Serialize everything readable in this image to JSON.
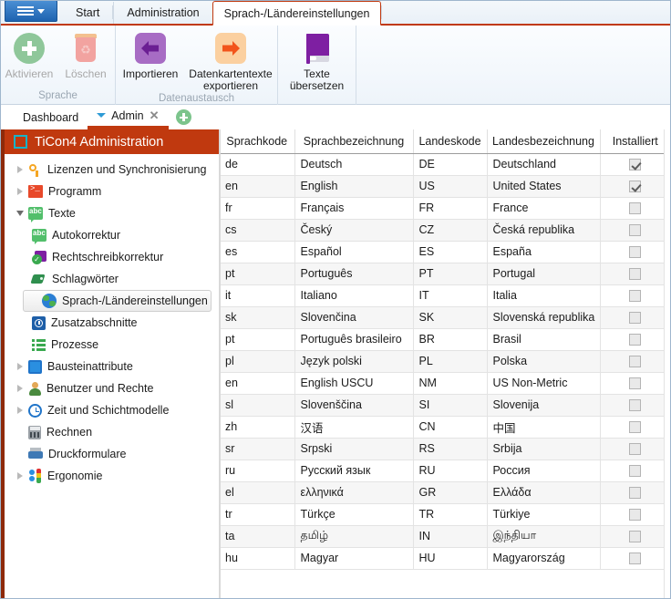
{
  "window": {
    "app_menu_icon": "hamburger-menu-icon"
  },
  "ribbon": {
    "tabs": [
      {
        "label": "Start",
        "active": false
      },
      {
        "label": "Administration",
        "active": false
      },
      {
        "label": "Sprach-/Ländereinstellungen",
        "active": true
      }
    ],
    "groups": [
      {
        "title": "Sprache",
        "buttons": [
          {
            "label": "Aktivieren",
            "icon": "plus-circle-icon",
            "disabled": true
          },
          {
            "label": "Löschen",
            "icon": "trash-icon",
            "disabled": true
          }
        ]
      },
      {
        "title": "Datenaustausch",
        "buttons": [
          {
            "label": "Importieren",
            "icon": "arrow-left-icon",
            "disabled": false
          },
          {
            "label": "Datenkartentexte exportieren",
            "icon": "arrow-right-icon",
            "disabled": false
          }
        ]
      },
      {
        "title": "",
        "buttons": [
          {
            "label": "Texte übersetzen",
            "icon": "book-icon",
            "disabled": false
          }
        ]
      }
    ]
  },
  "doc_tabs": {
    "items": [
      {
        "label": "Dashboard",
        "active": false,
        "closable": false,
        "has_dropdown": false
      },
      {
        "label": "Admin",
        "active": true,
        "closable": true,
        "has_dropdown": true
      }
    ],
    "add_label": "+"
  },
  "panel": {
    "title": "TiCon4 Administration",
    "icon": "frame-icon",
    "accent_color": "#c0390f"
  },
  "tree": {
    "items": [
      {
        "label": "Lizenzen und Synchronisierung",
        "icon": "key-icon",
        "indent": 0,
        "state": "collapsed",
        "selected": false
      },
      {
        "label": "Programm",
        "icon": "console-icon",
        "indent": 0,
        "state": "collapsed",
        "selected": false
      },
      {
        "label": "Texte",
        "icon": "abc-icon",
        "indent": 0,
        "state": "expanded",
        "selected": false
      },
      {
        "label": "Autokorrektur",
        "icon": "abc-icon",
        "indent": 1,
        "state": "leaf",
        "selected": false
      },
      {
        "label": "Rechtschreibkorrektur",
        "icon": "spellcheck-icon",
        "indent": 1,
        "state": "leaf",
        "selected": false
      },
      {
        "label": "Schlagwörter",
        "icon": "tag-icon",
        "indent": 1,
        "state": "leaf",
        "selected": false
      },
      {
        "label": "Sprach-/Ländereinstellungen",
        "icon": "globe-icon",
        "indent": 1,
        "state": "leaf",
        "selected": true
      },
      {
        "label": "Zusatzabschnitte",
        "icon": "clock-box-icon",
        "indent": 1,
        "state": "leaf",
        "selected": false
      },
      {
        "label": "Prozesse",
        "icon": "list-icon",
        "indent": 1,
        "state": "leaf",
        "selected": false
      },
      {
        "label": "Bausteinattribute",
        "icon": "blue-square-icon",
        "indent": 0,
        "state": "collapsed",
        "selected": false
      },
      {
        "label": "Benutzer und Rechte",
        "icon": "user-icon",
        "indent": 0,
        "state": "collapsed",
        "selected": false
      },
      {
        "label": "Zeit und Schichtmodelle",
        "icon": "clock-icon",
        "indent": 0,
        "state": "collapsed",
        "selected": false
      },
      {
        "label": "Rechnen",
        "icon": "calculator-icon",
        "indent": 0,
        "state": "leaf",
        "selected": false
      },
      {
        "label": "Druckformulare",
        "icon": "printer-icon",
        "indent": 0,
        "state": "leaf",
        "selected": false
      },
      {
        "label": "Ergonomie",
        "icon": "ergonomics-icon",
        "indent": 0,
        "state": "collapsed",
        "selected": false
      }
    ]
  },
  "grid": {
    "columns": [
      "Sprachkode",
      "Sprachbezeichnung",
      "Landeskode",
      "Landesbezeichnung",
      "Installiert"
    ],
    "rows": [
      {
        "sprachkode": "de",
        "sprachbezeichnung": "Deutsch",
        "landeskode": "DE",
        "landesbezeichnung": "Deutschland",
        "installiert": true
      },
      {
        "sprachkode": "en",
        "sprachbezeichnung": "English",
        "landeskode": "US",
        "landesbezeichnung": "United States",
        "installiert": true
      },
      {
        "sprachkode": "fr",
        "sprachbezeichnung": "Français",
        "landeskode": "FR",
        "landesbezeichnung": "France",
        "installiert": false
      },
      {
        "sprachkode": "cs",
        "sprachbezeichnung": "Český",
        "landeskode": "CZ",
        "landesbezeichnung": "Česká republika",
        "installiert": false
      },
      {
        "sprachkode": "es",
        "sprachbezeichnung": "Español",
        "landeskode": "ES",
        "landesbezeichnung": "España",
        "installiert": false
      },
      {
        "sprachkode": "pt",
        "sprachbezeichnung": "Português",
        "landeskode": "PT",
        "landesbezeichnung": "Portugal",
        "installiert": false
      },
      {
        "sprachkode": "it",
        "sprachbezeichnung": "Italiano",
        "landeskode": "IT",
        "landesbezeichnung": "Italia",
        "installiert": false
      },
      {
        "sprachkode": "sk",
        "sprachbezeichnung": "Slovenčina",
        "landeskode": "SK",
        "landesbezeichnung": "Slovenská republika",
        "installiert": false
      },
      {
        "sprachkode": "pt",
        "sprachbezeichnung": "Português brasileiro",
        "landeskode": "BR",
        "landesbezeichnung": "Brasil",
        "installiert": false
      },
      {
        "sprachkode": "pl",
        "sprachbezeichnung": "Język polski",
        "landeskode": "PL",
        "landesbezeichnung": "Polska",
        "installiert": false
      },
      {
        "sprachkode": "en",
        "sprachbezeichnung": "English USCU",
        "landeskode": "NM",
        "landesbezeichnung": "US Non-Metric",
        "installiert": false
      },
      {
        "sprachkode": "sl",
        "sprachbezeichnung": "Slovenščina",
        "landeskode": "SI",
        "landesbezeichnung": "Slovenija",
        "installiert": false
      },
      {
        "sprachkode": "zh",
        "sprachbezeichnung": "汉语",
        "landeskode": "CN",
        "landesbezeichnung": "中国",
        "installiert": false
      },
      {
        "sprachkode": "sr",
        "sprachbezeichnung": "Srpski",
        "landeskode": "RS",
        "landesbezeichnung": "Srbija",
        "installiert": false
      },
      {
        "sprachkode": "ru",
        "sprachbezeichnung": "Русский язык",
        "landeskode": "RU",
        "landesbezeichnung": "Россия",
        "installiert": false
      },
      {
        "sprachkode": "el",
        "sprachbezeichnung": "ελληνικά",
        "landeskode": "GR",
        "landesbezeichnung": "Ελλάδα",
        "installiert": false
      },
      {
        "sprachkode": "tr",
        "sprachbezeichnung": "Türkçe",
        "landeskode": "TR",
        "landesbezeichnung": "Türkiye",
        "installiert": false
      },
      {
        "sprachkode": "ta",
        "sprachbezeichnung": "தமிழ்",
        "landeskode": "IN",
        "landesbezeichnung": "இந்தியா",
        "installiert": false
      },
      {
        "sprachkode": "hu",
        "sprachbezeichnung": "Magyar",
        "landeskode": "HU",
        "landesbezeichnung": "Magyarország",
        "installiert": false
      }
    ]
  }
}
